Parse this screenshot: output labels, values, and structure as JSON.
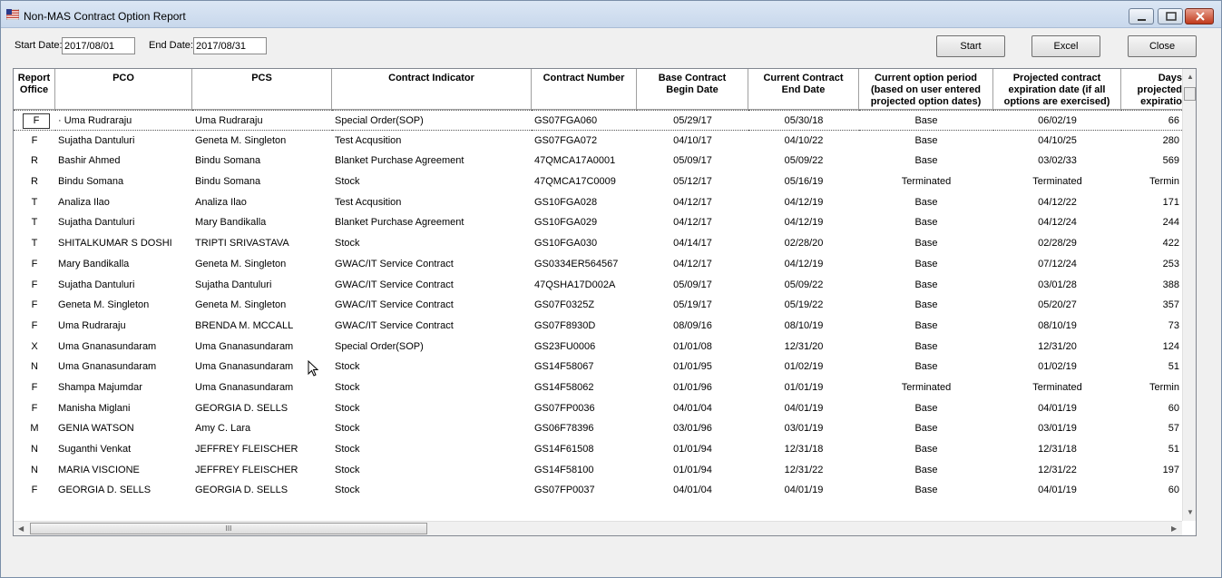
{
  "window": {
    "title": "Non-MAS Contract Option Report"
  },
  "filters": {
    "start_label": "Start Date:",
    "start_value": "2017/08/01",
    "end_label": "End Date:",
    "end_value": "2017/08/31"
  },
  "buttons": {
    "start": "Start",
    "excel": "Excel",
    "close": "Close"
  },
  "columns": [
    "Report\nOffice",
    "PCO",
    "PCS",
    "Contract Indicator",
    "Contract Number",
    "Base Contract\nBegin Date",
    "Current Contract\nEnd Date",
    "Current option period\n(based on user entered\nprojected option dates)",
    "Projected contract\nexpiration date (if all\noptions are exercised)",
    "Days\nprojected\nexpiratio"
  ],
  "rows": [
    [
      "F",
      "· Uma Rudraraju",
      "Uma Rudraraju",
      "Special Order(SOP)",
      "GS07FGA060",
      "05/29/17",
      "05/30/18",
      "Base",
      "06/02/19",
      "66"
    ],
    [
      "F",
      "Sujatha Dantuluri",
      "Geneta M. Singleton",
      "Test Acqusition",
      "GS07FGA072",
      "04/10/17",
      "04/10/22",
      "Base",
      "04/10/25",
      "280"
    ],
    [
      "R",
      "Bashir Ahmed",
      "Bindu Somana",
      "Blanket Purchase Agreement",
      "47QMCA17A0001",
      "05/09/17",
      "05/09/22",
      "Base",
      "03/02/33",
      "569"
    ],
    [
      "R",
      "Bindu Somana",
      "Bindu Somana",
      "Stock",
      "47QMCA17C0009",
      "05/12/17",
      "05/16/19",
      "Terminated",
      "Terminated",
      "Termin"
    ],
    [
      "T",
      "Analiza Ilao",
      "Analiza Ilao",
      "Test Acqusition",
      "GS10FGA028",
      "04/12/17",
      "04/12/19",
      "Base",
      "04/12/22",
      "171"
    ],
    [
      "T",
      "Sujatha Dantuluri",
      "Mary Bandikalla",
      "Blanket Purchase Agreement",
      "GS10FGA029",
      "04/12/17",
      "04/12/19",
      "Base",
      "04/12/24",
      "244"
    ],
    [
      "T",
      "SHITALKUMAR S DOSHI",
      "TRIPTI SRIVASTAVA",
      "Stock",
      "GS10FGA030",
      "04/14/17",
      "02/28/20",
      "Base",
      "02/28/29",
      "422"
    ],
    [
      "F",
      "Mary Bandikalla",
      "Geneta M. Singleton",
      "GWAC/IT Service Contract",
      "GS0334ER564567",
      "04/12/17",
      "04/12/19",
      "Base",
      "07/12/24",
      "253"
    ],
    [
      "F",
      "Sujatha Dantuluri",
      "Sujatha Dantuluri",
      "GWAC/IT Service Contract",
      "47QSHA17D002A",
      "05/09/17",
      "05/09/22",
      "Base",
      "03/01/28",
      "388"
    ],
    [
      "F",
      "Geneta M. Singleton",
      "Geneta M. Singleton",
      "GWAC/IT Service Contract",
      "GS07F0325Z",
      "05/19/17",
      "05/19/22",
      "Base",
      "05/20/27",
      "357"
    ],
    [
      "F",
      "Uma Rudraraju",
      "BRENDA M. MCCALL",
      "GWAC/IT Service Contract",
      "GS07F8930D",
      "08/09/16",
      "08/10/19",
      "Base",
      "08/10/19",
      "73"
    ],
    [
      "X",
      "Uma Gnanasundaram",
      "Uma Gnanasundaram",
      "Special Order(SOP)",
      "GS23FU0006",
      "01/01/08",
      "12/31/20",
      "Base",
      "12/31/20",
      "124"
    ],
    [
      "N",
      "Uma Gnanasundaram",
      "Uma Gnanasundaram",
      "Stock",
      "GS14F58067",
      "01/01/95",
      "01/02/19",
      "Base",
      "01/02/19",
      "51"
    ],
    [
      "F",
      "Shampa Majumdar",
      "Uma Gnanasundaram",
      "Stock",
      "GS14F58062",
      "01/01/96",
      "01/01/19",
      "Terminated",
      "Terminated",
      "Termin"
    ],
    [
      "F",
      "Manisha Miglani",
      "GEORGIA D. SELLS",
      "Stock",
      "GS07FP0036",
      "04/01/04",
      "04/01/19",
      "Base",
      "04/01/19",
      "60"
    ],
    [
      "M",
      "GENIA WATSON",
      "Amy C. Lara",
      "Stock",
      "GS06F78396",
      "03/01/96",
      "03/01/19",
      "Base",
      "03/01/19",
      "57"
    ],
    [
      "N",
      "Suganthi Venkat",
      "JEFFREY FLEISCHER",
      "Stock",
      "GS14F61508",
      "01/01/94",
      "12/31/18",
      "Base",
      "12/31/18",
      "51"
    ],
    [
      "N",
      "MARIA VISCIONE",
      "JEFFREY FLEISCHER",
      "Stock",
      "GS14F58100",
      "01/01/94",
      "12/31/22",
      "Base",
      "12/31/22",
      "197"
    ],
    [
      "F",
      "GEORGIA D. SELLS",
      "GEORGIA D. SELLS",
      "Stock",
      "GS07FP0037",
      "04/01/04",
      "04/01/19",
      "Base",
      "04/01/19",
      "60"
    ]
  ],
  "scrollbar": {
    "thumb_grip": "III"
  }
}
